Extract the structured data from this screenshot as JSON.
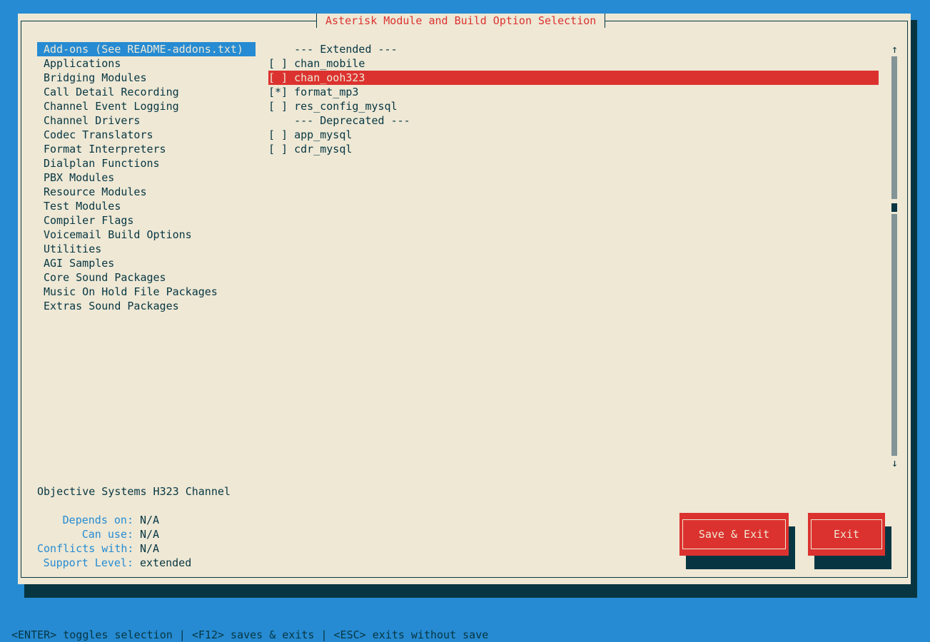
{
  "title": "Asterisk Module and Build Option Selection",
  "categories": [
    "Add-ons (See README-addons.txt)",
    "Applications",
    "Bridging Modules",
    "Call Detail Recording",
    "Channel Event Logging",
    "Channel Drivers",
    "Codec Translators",
    "Format Interpreters",
    "Dialplan Functions",
    "PBX Modules",
    "Resource Modules",
    "Test Modules",
    "Compiler Flags",
    "Voicemail Build Options",
    "Utilities",
    "AGI Samples",
    "Core Sound Packages",
    "Music On Hold File Packages",
    "Extras Sound Packages"
  ],
  "selected_category": "Add-ons (See README-addons.txt)",
  "options": [
    {
      "text": "    --- Extended ---"
    },
    {
      "text": "[ ] chan_mobile"
    },
    {
      "text": "[ ] chan_ooh323"
    },
    {
      "text": "[*] format_mp3"
    },
    {
      "text": "[ ] res_config_mysql"
    },
    {
      "text": "    --- Deprecated ---"
    },
    {
      "text": "[ ] app_mysql"
    },
    {
      "text": "[ ] cdr_mysql"
    }
  ],
  "selected_option": "[ ] chan_ooh323",
  "scroll_up_arrow": "↑",
  "scroll_down_arrow": "↓",
  "description": "Objective Systems H323 Channel",
  "details": {
    "depends_on_label": "Depends on:",
    "depends_on": "N/A",
    "can_use_label": "Can use:",
    "can_use": "N/A",
    "conflicts_with_label": "Conflicts with:",
    "conflicts_with": "N/A",
    "support_level_label": "Support Level:",
    "support_level": "extended"
  },
  "buttons": {
    "save_exit": "Save & Exit",
    "exit": "Exit"
  },
  "hint": "<ENTER> toggles selection | <F12> saves & exits | <ESC> exits without save",
  "colors": {
    "background": "#268bd2",
    "dialog": "#eee8d5",
    "accent_red": "#dc322f",
    "shadow": "#073642"
  }
}
